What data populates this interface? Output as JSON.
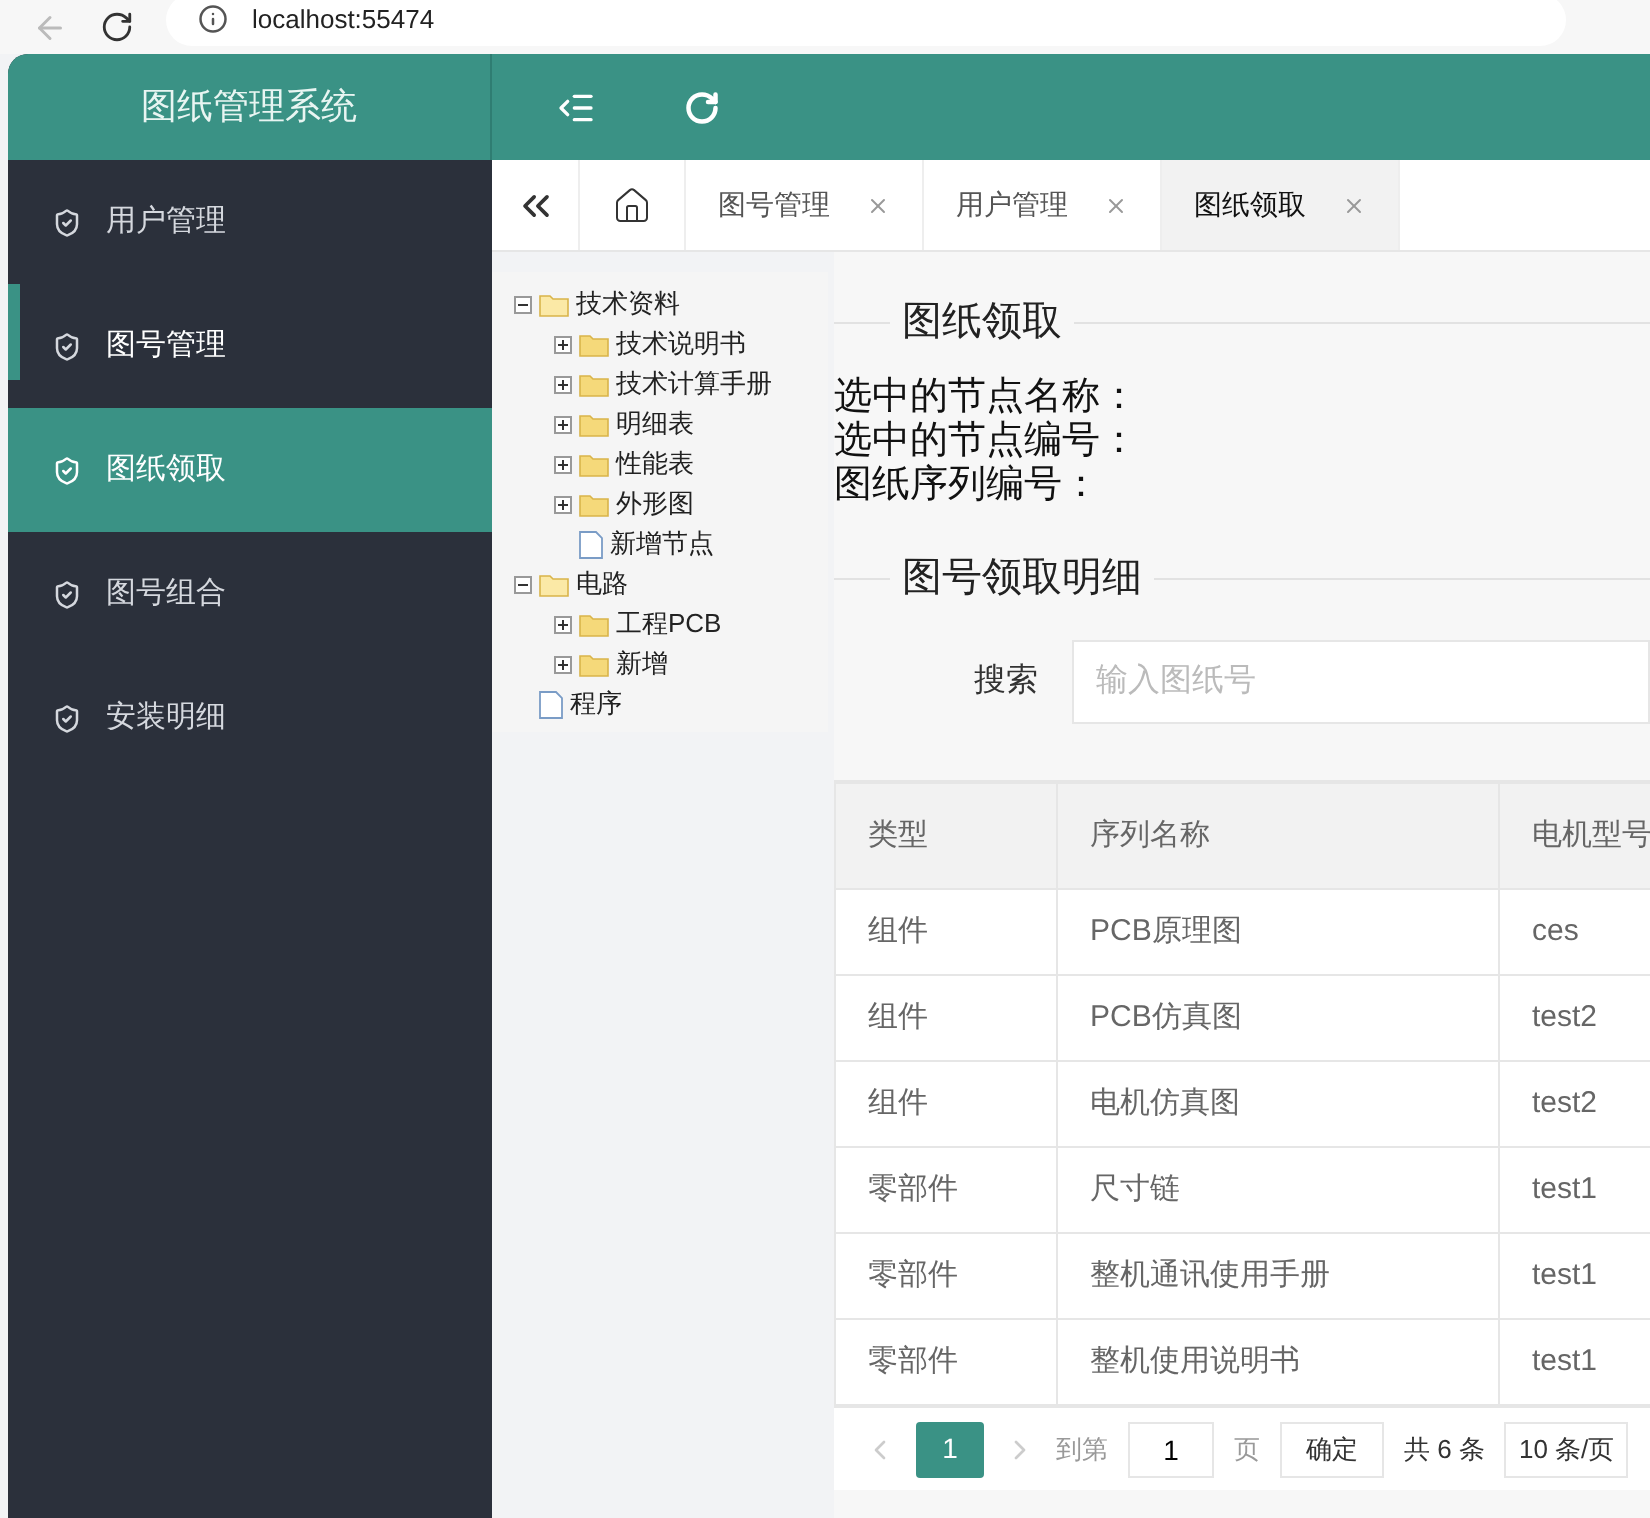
{
  "browser": {
    "url": "localhost:55474"
  },
  "header": {
    "title": "图纸管理系统"
  },
  "sidebar": {
    "items": [
      {
        "label": "用户管理",
        "selected": false,
        "highlighted": false
      },
      {
        "label": "图号管理",
        "selected": false,
        "highlighted": true
      },
      {
        "label": "图纸领取",
        "selected": true,
        "highlighted": false
      },
      {
        "label": "图号组合",
        "selected": false,
        "highlighted": false
      },
      {
        "label": "安装明细",
        "selected": false,
        "highlighted": false
      }
    ]
  },
  "tabs": [
    {
      "label": "图号管理",
      "selected": false
    },
    {
      "label": "用户管理",
      "selected": false
    },
    {
      "label": "图纸领取",
      "selected": true
    }
  ],
  "tree": [
    {
      "label": "技术资料",
      "kind": "folder",
      "expanded": true,
      "children": [
        {
          "label": "技术说明书",
          "kind": "folder",
          "expanded": false
        },
        {
          "label": "技术计算手册",
          "kind": "folder",
          "expanded": false
        },
        {
          "label": "明细表",
          "kind": "folder",
          "expanded": false
        },
        {
          "label": "性能表",
          "kind": "folder",
          "expanded": false
        },
        {
          "label": "外形图",
          "kind": "folder",
          "expanded": false
        },
        {
          "label": "新增节点",
          "kind": "file"
        }
      ]
    },
    {
      "label": "电路",
      "kind": "folder",
      "expanded": true,
      "children": [
        {
          "label": "工程PCB",
          "kind": "folder",
          "expanded": false
        },
        {
          "label": "新增",
          "kind": "folder",
          "expanded": false
        }
      ]
    },
    {
      "label": "程序",
      "kind": "file"
    }
  ],
  "section1": {
    "legend": "图纸领取",
    "lines": [
      "选中的节点名称：",
      "选中的节点编号：",
      "图纸序列编号："
    ]
  },
  "section2": {
    "legend": "图号领取明细",
    "search_label": "搜索",
    "search_placeholder": "输入图纸号"
  },
  "table": {
    "columns": [
      "类型",
      "序列名称",
      "电机型号"
    ],
    "rows": [
      [
        "组件",
        "PCB原理图",
        "ces"
      ],
      [
        "组件",
        "PCB仿真图",
        "test2"
      ],
      [
        "组件",
        "电机仿真图",
        "test2"
      ],
      [
        "零部件",
        "尺寸链",
        "test1"
      ],
      [
        "零部件",
        "整机通讯使用手册",
        "test1"
      ],
      [
        "零部件",
        "整机使用说明书",
        "test1"
      ]
    ]
  },
  "pagination": {
    "pages": [
      {
        "label": "1",
        "selected": true
      }
    ],
    "goto_label": "到第",
    "goto_value": "1",
    "page_unit": "页",
    "confirm": "确定",
    "total": "共 6 条",
    "page_size": "10 条/页"
  }
}
